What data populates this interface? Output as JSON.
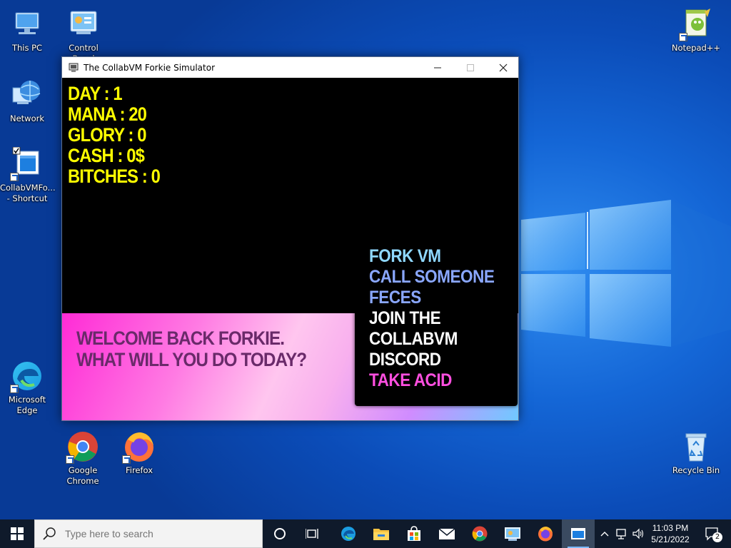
{
  "desktop": {
    "icons": [
      {
        "label": "This PC"
      },
      {
        "label": "Control Panel"
      },
      {
        "label": "Network"
      },
      {
        "label": "CollabVMFo... - Shortcut"
      },
      {
        "label": "Microsoft Edge"
      },
      {
        "label": "Google Chrome"
      },
      {
        "label": "Firefox"
      },
      {
        "label": "Notepad++"
      },
      {
        "label": "Recycle Bin"
      }
    ]
  },
  "window": {
    "title": "The CollabVM Forkie Simulator",
    "stats": [
      "DAY : 1",
      "MANA : 20",
      "GLORY : 0",
      "CASH : 0$",
      "BITCHES : 0"
    ],
    "banner_lines": [
      "WELCOME BACK FORKIE.",
      "WHAT WILL YOU DO TODAY?"
    ],
    "menu": [
      {
        "label": "FORK VM",
        "color": "#8fd8ff"
      },
      {
        "label": "CALL SOMEONE",
        "color": "#8aa7ff"
      },
      {
        "label": "FECES",
        "color": "#8aa7ff"
      },
      {
        "label": "JOIN THE",
        "color": "#ffffff"
      },
      {
        "label": "COLLABVM",
        "color": "#ffffff"
      },
      {
        "label": "DISCORD",
        "color": "#ffffff"
      },
      {
        "label": "TAKE ACID",
        "color": "#ff4fe0"
      }
    ],
    "stats_color": "#ffff00",
    "banner_text_color": "#6a2a6a"
  },
  "taskbar": {
    "search_placeholder": "Type here to search",
    "time": "11:03 PM",
    "date": "5/21/2022",
    "notification_count": "2"
  }
}
